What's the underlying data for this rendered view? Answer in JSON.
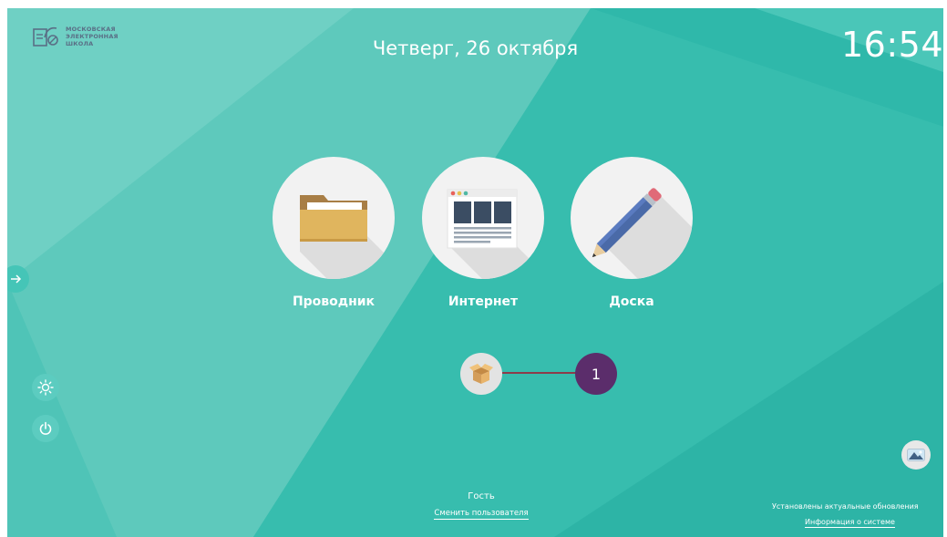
{
  "colors": {
    "background": "#3bbfb0",
    "accent_badge": "#5b2d6b",
    "connector": "#8c3c4a"
  },
  "logo": {
    "lines": [
      "МОСКОВСКАЯ",
      "ЭЛЕКТРОННАЯ",
      "ШКОЛА"
    ],
    "icon": "mesh-logo-icon"
  },
  "header": {
    "date": "Четверг, 26 октября",
    "time": "16:54"
  },
  "apps": [
    {
      "label": "Проводник",
      "icon": "folder-icon"
    },
    {
      "label": "Интернет",
      "icon": "browser-icon"
    },
    {
      "label": "Доска",
      "icon": "pencil-icon"
    }
  ],
  "side_panel": {
    "toggle_icon": "arrow-right-icon"
  },
  "controls": {
    "brightness_icon": "brightness-icon",
    "power_icon": "power-icon"
  },
  "apps_row": {
    "package_icon": "package-box-icon",
    "badge_count": "1"
  },
  "user": {
    "name": "Гость",
    "switch_link": "Сменить пользователя"
  },
  "system": {
    "wallpaper_icon": "wallpaper-icon",
    "update_status": "Установлены актуальные обновления",
    "info_link": "Информация о системе"
  }
}
